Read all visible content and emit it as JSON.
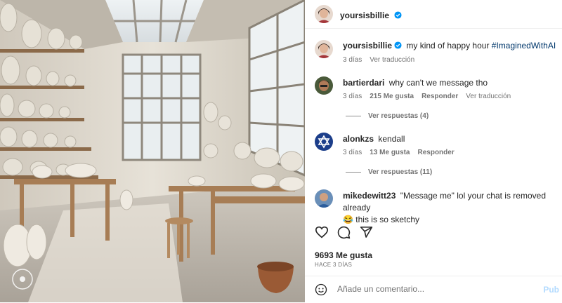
{
  "colors": {
    "accent": "#0095f6",
    "hashtag": "#00376b",
    "muted": "#737373"
  },
  "post": {
    "author": "yoursisbillie",
    "caption_text": "my kind of happy hour ",
    "caption_hashtag": "#ImaginedWithAI",
    "caption_age": "3 días",
    "see_translation": "Ver traducción"
  },
  "comments": [
    {
      "user": "bartierdari",
      "text": "why can't we message tho",
      "age": "3 días",
      "likes": "215 Me gusta",
      "reply": "Responder",
      "translate": "Ver traducción",
      "view_replies": "Ver respuestas (4)"
    },
    {
      "user": "alonkzs",
      "text": "kendall",
      "age": "3 días",
      "likes": "13 Me gusta",
      "reply": "Responder",
      "view_replies": "Ver respuestas (11)"
    },
    {
      "user": "mikedewitt23",
      "text_line1": "\"Message me\" lol your chat is removed already",
      "text_line2": "this is so sketchy",
      "emoji": "😂"
    }
  ],
  "stats": {
    "likes": "9693 Me gusta",
    "posted": "HACE 3 DÍAS"
  },
  "composer": {
    "placeholder": "Añade un comentario...",
    "post_label": "Pub"
  },
  "icons": [
    "heart-icon",
    "comment-icon",
    "share-icon",
    "emoji-icon",
    "verified-icon"
  ]
}
